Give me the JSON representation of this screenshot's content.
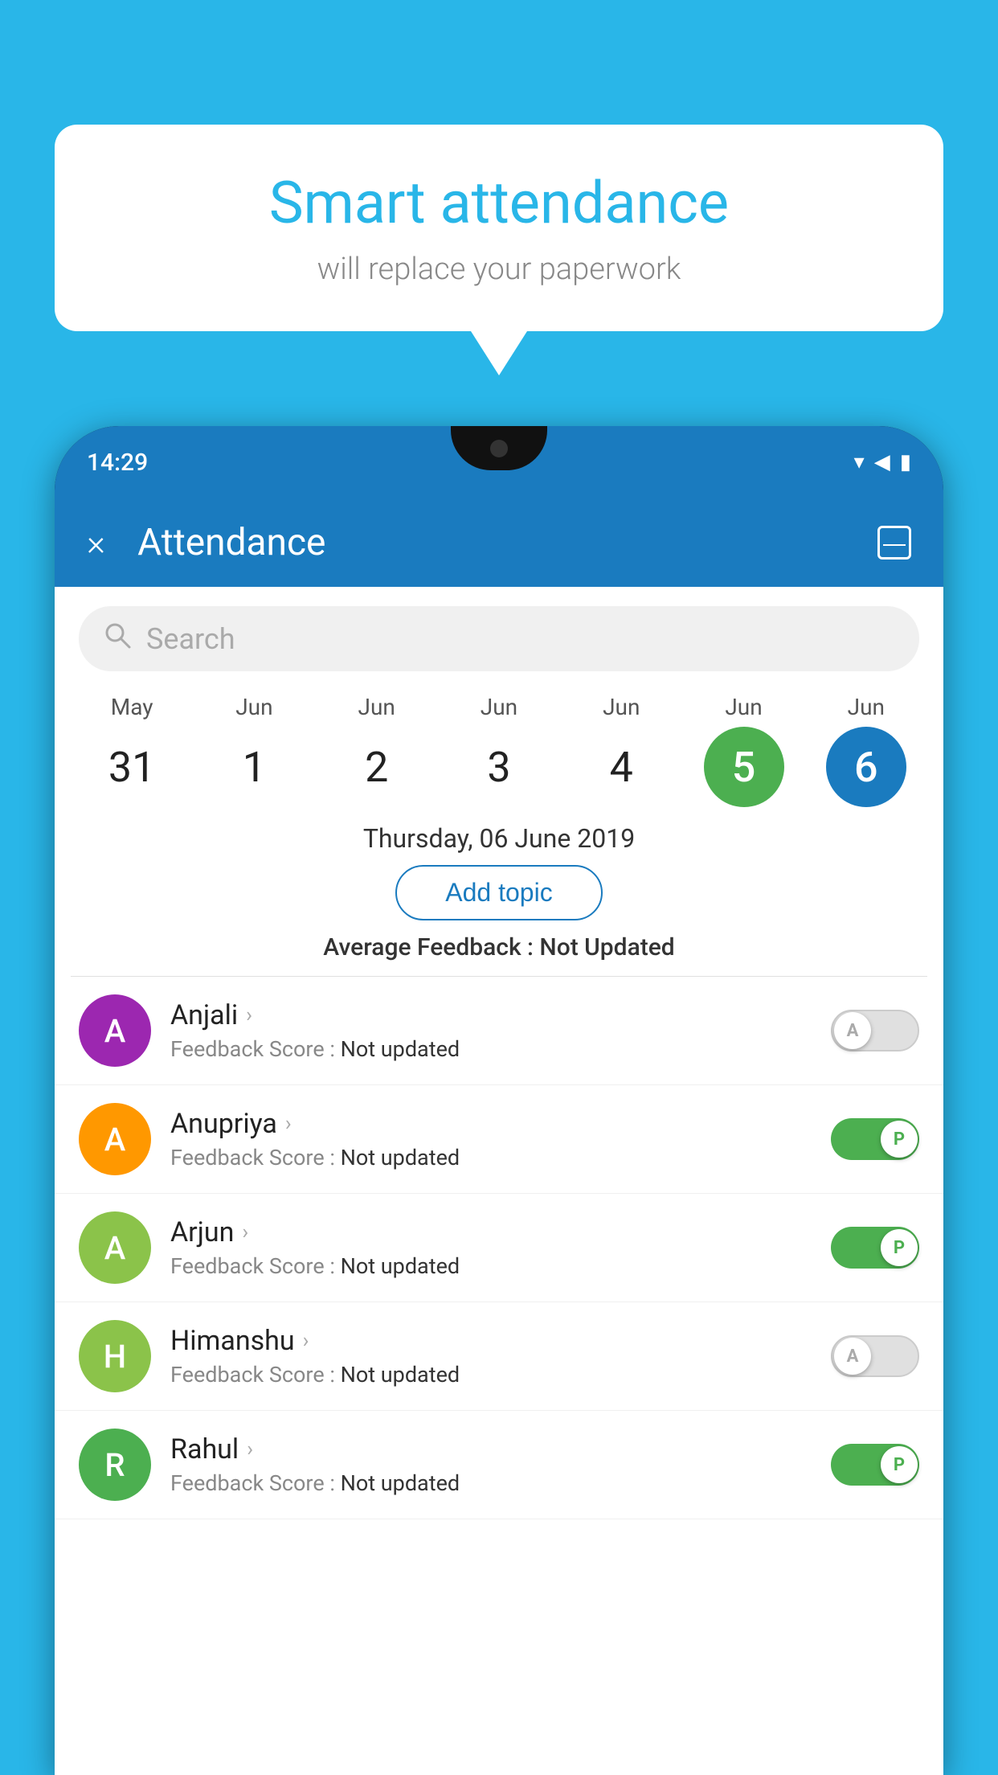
{
  "background": "#29b6e8",
  "speech_bubble": {
    "title": "Smart attendance",
    "subtitle": "will replace your paperwork"
  },
  "phone": {
    "time": "14:29",
    "app": {
      "topbar": {
        "close_label": "×",
        "title": "Attendance",
        "calendar_label": "📅"
      },
      "search": {
        "placeholder": "Search"
      },
      "calendar": {
        "dates": [
          {
            "month": "May",
            "day": "31",
            "state": "normal"
          },
          {
            "month": "Jun",
            "day": "1",
            "state": "normal"
          },
          {
            "month": "Jun",
            "day": "2",
            "state": "normal"
          },
          {
            "month": "Jun",
            "day": "3",
            "state": "normal"
          },
          {
            "month": "Jun",
            "day": "4",
            "state": "normal"
          },
          {
            "month": "Jun",
            "day": "5",
            "state": "today"
          },
          {
            "month": "Jun",
            "day": "6",
            "state": "selected"
          }
        ]
      },
      "selected_date": "Thursday, 06 June 2019",
      "add_topic_label": "Add topic",
      "avg_feedback_label": "Average Feedback :",
      "avg_feedback_value": "Not Updated",
      "students": [
        {
          "name": "Anjali",
          "avatar_letter": "A",
          "avatar_color": "#9c27b0",
          "feedback_label": "Feedback Score :",
          "feedback_value": "Not updated",
          "toggle_state": "off",
          "toggle_label": "A"
        },
        {
          "name": "Anupriya",
          "avatar_letter": "A",
          "avatar_color": "#ff9800",
          "feedback_label": "Feedback Score :",
          "feedback_value": "Not updated",
          "toggle_state": "on",
          "toggle_label": "P"
        },
        {
          "name": "Arjun",
          "avatar_letter": "A",
          "avatar_color": "#8bc34a",
          "feedback_label": "Feedback Score :",
          "feedback_value": "Not updated",
          "toggle_state": "on",
          "toggle_label": "P"
        },
        {
          "name": "Himanshu",
          "avatar_letter": "H",
          "avatar_color": "#8bc34a",
          "feedback_label": "Feedback Score :",
          "feedback_value": "Not updated",
          "toggle_state": "off",
          "toggle_label": "A"
        },
        {
          "name": "Rahul",
          "avatar_letter": "R",
          "avatar_color": "#4caf50",
          "feedback_label": "Feedback Score :",
          "feedback_value": "Not updated",
          "toggle_state": "on",
          "toggle_label": "P"
        }
      ]
    }
  }
}
